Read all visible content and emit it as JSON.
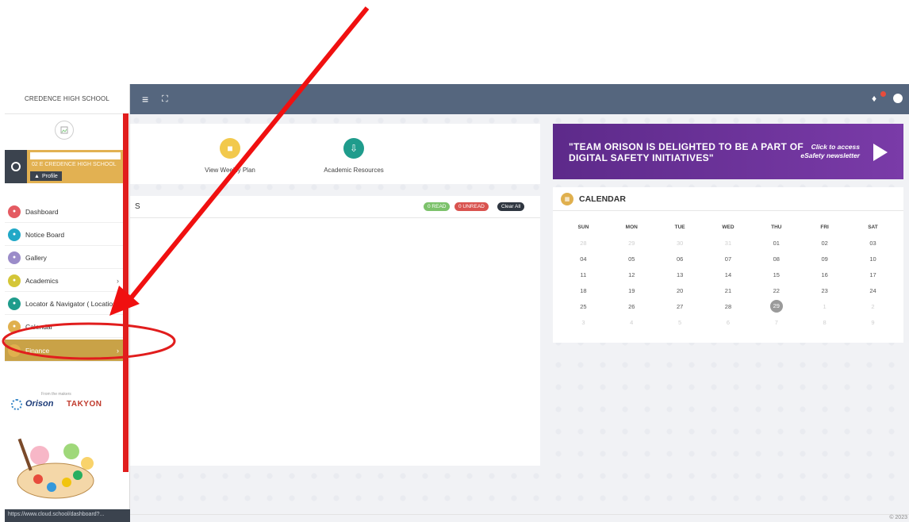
{
  "sidebar": {
    "school_name": "CREDENCE HIGH SCHOOL",
    "logo_icon": "broken-image-icon",
    "user": {
      "school_line": "02 E   CREDENCE HIGH SCHOOL",
      "profile_label": "Profile"
    },
    "items": [
      {
        "label": "Dashboard",
        "icon": "dashboard-icon",
        "color": "#e45b62",
        "chevron": ""
      },
      {
        "label": "Notice Board",
        "icon": "notice-icon",
        "color": "#21a8c7",
        "chevron": ""
      },
      {
        "label": "Gallery",
        "icon": "gallery-icon",
        "color": "#9b8cc9",
        "chevron": ""
      },
      {
        "label": "Academics",
        "icon": "academics-icon",
        "color": "#d4c638",
        "chevron": "›"
      },
      {
        "label": "Locator & Navigator ( Location",
        "icon": "location-icon",
        "color": "#1f9c8c",
        "chevron": ""
      },
      {
        "label": "Calendar",
        "icon": "calendar-icon",
        "color": "#e0b04e",
        "chevron": ""
      },
      {
        "label": "Finance",
        "icon": "finance-icon",
        "color": "#e0b04e",
        "chevron": "›"
      }
    ],
    "brands": {
      "tagline": "From the makers",
      "orison": "Orison",
      "takyon": "TAKYON"
    },
    "status_url": "https://www.cloud.school/dashboard?..."
  },
  "topbar": {
    "menu_icon": "hamburger-icon",
    "fullscreen_icon": "expand-icon",
    "notification_icon": "bell-icon",
    "user_icon": "user-icon"
  },
  "quick_links": [
    {
      "label": "View Weekly Plan",
      "icon": "weekly-plan-icon",
      "color": "#f2c94c"
    },
    {
      "label": "Academic Resources",
      "icon": "resources-icon",
      "color": "#1f9c8c"
    }
  ],
  "notices": {
    "title": "S",
    "read": "0 READ",
    "unread": "0 UNREAD",
    "clear": "Clear All"
  },
  "banner": {
    "line1": "\"TEAM ORISON IS DELIGHTED TO BE A PART OF",
    "line2": "DIGITAL SAFETY INITIATIVES\"",
    "cta1": "Click to access",
    "cta2": "eSafety newsletter"
  },
  "calendar": {
    "title": "CALENDAR",
    "weekdays": [
      "SUN",
      "MON",
      "TUE",
      "WED",
      "THU",
      "FRI",
      "SAT"
    ],
    "weeks": [
      [
        {
          "d": "28",
          "o": true
        },
        {
          "d": "29",
          "o": true
        },
        {
          "d": "30",
          "o": true
        },
        {
          "d": "31",
          "o": true
        },
        {
          "d": "01"
        },
        {
          "d": "02"
        },
        {
          "d": "03"
        }
      ],
      [
        {
          "d": "04"
        },
        {
          "d": "05"
        },
        {
          "d": "06"
        },
        {
          "d": "07"
        },
        {
          "d": "08"
        },
        {
          "d": "09"
        },
        {
          "d": "10"
        }
      ],
      [
        {
          "d": "11"
        },
        {
          "d": "12"
        },
        {
          "d": "13"
        },
        {
          "d": "14"
        },
        {
          "d": "15"
        },
        {
          "d": "16"
        },
        {
          "d": "17"
        }
      ],
      [
        {
          "d": "18"
        },
        {
          "d": "19"
        },
        {
          "d": "20"
        },
        {
          "d": "21"
        },
        {
          "d": "22"
        },
        {
          "d": "23"
        },
        {
          "d": "24"
        }
      ],
      [
        {
          "d": "25"
        },
        {
          "d": "26"
        },
        {
          "d": "27"
        },
        {
          "d": "28"
        },
        {
          "d": "29",
          "t": true
        },
        {
          "d": "1",
          "o": true
        },
        {
          "d": "2",
          "o": true
        }
      ],
      [
        {
          "d": "3",
          "o": true
        },
        {
          "d": "4",
          "o": true
        },
        {
          "d": "5",
          "o": true
        },
        {
          "d": "6",
          "o": true
        },
        {
          "d": "7",
          "o": true
        },
        {
          "d": "8",
          "o": true
        },
        {
          "d": "9",
          "o": true
        }
      ]
    ]
  },
  "footer": {
    "copyright": "© 2023"
  },
  "colors": {
    "topbar": "#55667e",
    "accent": "#e0b04e",
    "annotation": "#e11d1d"
  }
}
